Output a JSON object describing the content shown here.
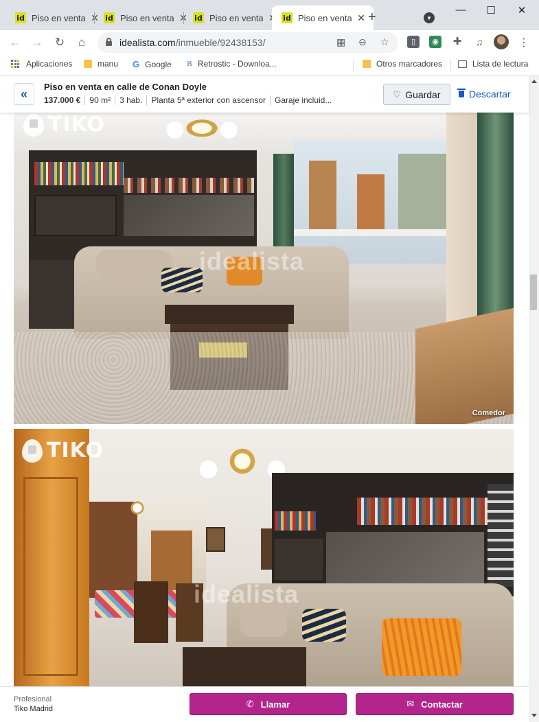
{
  "browser": {
    "tabs": [
      {
        "title": "Piso en venta en",
        "active": false
      },
      {
        "title": "Piso en venta en",
        "active": false
      },
      {
        "title": "Piso en venta en",
        "active": false
      },
      {
        "title": "Piso en venta en",
        "active": true
      }
    ],
    "favicon_text": "id",
    "new_tab_symbol": "+",
    "url_host": "idealista.com",
    "url_path": "/inmueble/92438153/",
    "colors": {
      "tabstrip": "#dee1e6",
      "favicon": "#d8e21c"
    }
  },
  "bookmarks": {
    "apps": "Aplicaciones",
    "manu": "manu",
    "google": "Google",
    "retrostic": "Retrostic - Downloa...",
    "other": "Otros marcadores",
    "reading_list": "Lista de lectura"
  },
  "listing": {
    "back_symbol": "«",
    "title": "Piso en venta en calle de Conan Doyle",
    "price": "137.000 €",
    "area": "90 m²",
    "rooms": "3 hab.",
    "floor": "Planta 5ª exterior con ascensor",
    "extra": "Garaje incluid...",
    "save_label": "Guardar",
    "discard_label": "Descartar",
    "colors": {
      "link": "#1a56c4",
      "cta": "#b3258a"
    }
  },
  "photos": [
    {
      "logo_text": "TIKO",
      "watermark": "idealista",
      "caption": "Comedor"
    },
    {
      "logo_text": "TIKO",
      "watermark": "idealista",
      "caption": ""
    }
  ],
  "footer": {
    "role": "Profesional",
    "agency": "Tiko Madrid",
    "call_label": "Llamar",
    "contact_label": "Contactar"
  }
}
